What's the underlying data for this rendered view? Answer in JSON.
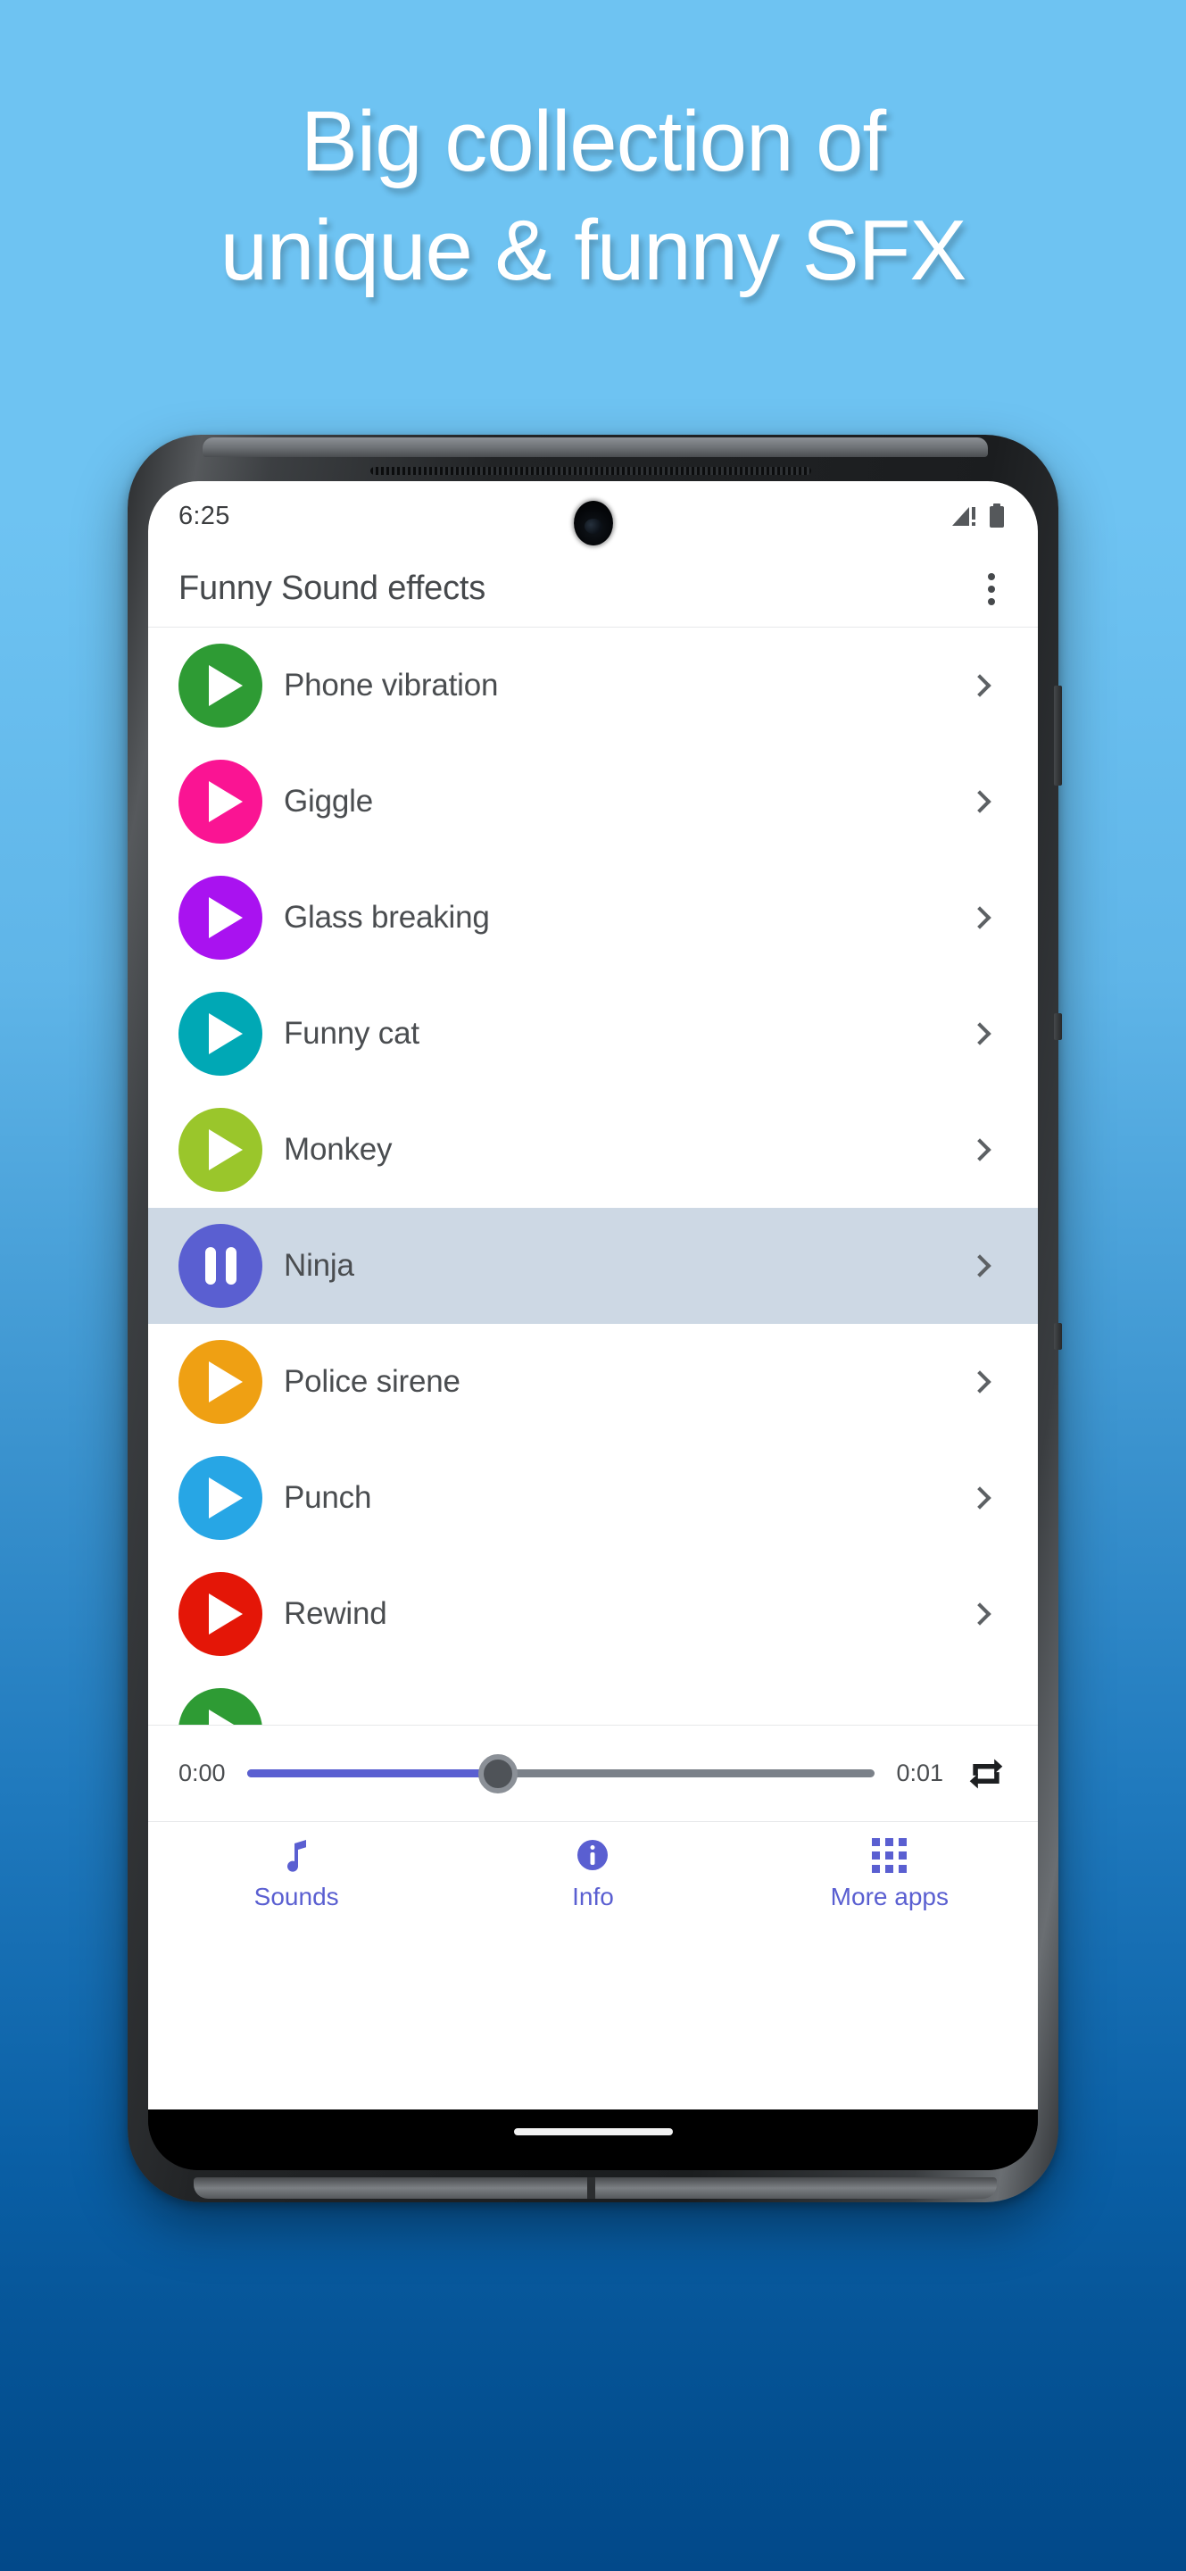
{
  "promo": {
    "headline": "Big collection of\nunique & funny SFX",
    "bg_top": "#6ec3f2",
    "bg_bottom": "#02498a"
  },
  "status_bar": {
    "time": "6:25",
    "signal_icon": "signal-bars-icon",
    "battery_icon": "battery-icon",
    "camera_icon": "front-camera-punchhole"
  },
  "app_bar": {
    "title": "Funny Sound effects",
    "overflow_icon": "more-vert-icon"
  },
  "sounds": {
    "items": [
      {
        "label": "Phone vibration",
        "color": "#2e9b34",
        "state": "play"
      },
      {
        "label": "Giggle",
        "color": "#fa1493",
        "state": "play"
      },
      {
        "label": "Glass breaking",
        "color": "#a912f0",
        "state": "play"
      },
      {
        "label": "Funny cat",
        "color": "#00a8b5",
        "state": "play"
      },
      {
        "label": "Monkey",
        "color": "#9ac62b",
        "state": "play"
      },
      {
        "label": "Ninja",
        "color": "#5a5fd1",
        "state": "pause"
      },
      {
        "label": "Police sirene",
        "color": "#efa013",
        "state": "play"
      },
      {
        "label": "Punch",
        "color": "#27a6e5",
        "state": "play"
      },
      {
        "label": "Rewind",
        "color": "#e41607",
        "state": "play"
      },
      {
        "label": "",
        "color": "#2e9b34",
        "state": "play"
      }
    ],
    "active_index": 5,
    "active_row_color": "#cdd8e4",
    "chevron_icon": "chevron-right-icon"
  },
  "player": {
    "current_time": "0:00",
    "total_time": "0:01",
    "progress_percent": 40,
    "fill_color": "#5a5fd1",
    "track_color": "#7b8189",
    "repeat_icon": "repeat-icon"
  },
  "bottom_nav": {
    "accent": "#5a5fd1",
    "items": [
      {
        "label": "Sounds",
        "icon": "music-note-icon"
      },
      {
        "label": "Info",
        "icon": "info-circle-icon"
      },
      {
        "label": "More apps",
        "icon": "grid-apps-icon"
      }
    ]
  },
  "gesture_bar": {
    "handle": "home-gesture-pill"
  }
}
